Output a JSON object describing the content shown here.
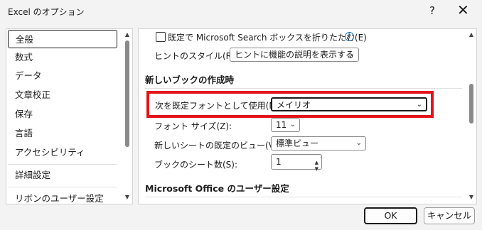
{
  "window": {
    "title": "Excel のオプション",
    "help_label": "?",
    "close_label": "✕"
  },
  "sidebar": {
    "items": [
      {
        "label": "全般",
        "selected": true
      },
      {
        "label": "数式"
      },
      {
        "label": "データ"
      },
      {
        "label": "文章校正"
      },
      {
        "label": "保存"
      },
      {
        "label": "言語"
      },
      {
        "label": "アクセシビリティ"
      },
      {
        "label": "詳細設定"
      },
      {
        "label": "リボンのユーザー設定"
      }
    ]
  },
  "main": {
    "search_checkbox_label": "既定で Microsoft Search ボックスを折りたたむ(E)",
    "tooltip_style_label": "ヒントのスタイル(R):",
    "tooltip_style_value": "ヒントに機能の説明を表示する",
    "new_workbook_heading": "新しいブックの作成時",
    "default_font_label": "次を既定フォントとして使用(N):",
    "default_font_value": "メイリオ",
    "font_size_label": "フォント サイズ(Z):",
    "font_size_value": "11",
    "default_view_label": "新しいシートの既定のビュー(V):",
    "default_view_value": "標準ビュー",
    "sheet_count_label": "ブックのシート数(S):",
    "sheet_count_value": "1",
    "office_heading": "Microsoft Office のユーザー設定"
  },
  "buttons": {
    "ok": "OK",
    "cancel": "キャンセル"
  },
  "icons": {
    "info": "info-icon",
    "chevron": "chevron-down-icon",
    "spin": "spin-arrows-icon"
  },
  "colors": {
    "highlight": "#e3131b",
    "accent": "#0f6cbd"
  }
}
